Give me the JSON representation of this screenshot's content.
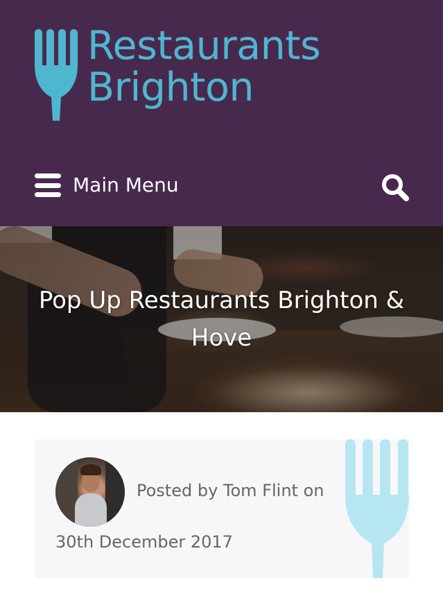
{
  "site": {
    "logo_line1": "Restaurants",
    "logo_line2": "Brighton",
    "logo_icon": "fork-icon"
  },
  "nav": {
    "menu_icon": "hamburger-icon",
    "menu_label": "Main Menu",
    "search_icon": "search-icon"
  },
  "hero": {
    "title": "Pop Up Restaurants Brighton & Hove"
  },
  "author": {
    "posted_by": "Posted by Tom Flint on",
    "date": "30th December 2017"
  },
  "colors": {
    "header_bg": "#48294e",
    "logo": "#4fb6d0",
    "card_bg": "#f7f7f9",
    "card_fork": "#b6e6f2",
    "meta_text": "#666666"
  }
}
